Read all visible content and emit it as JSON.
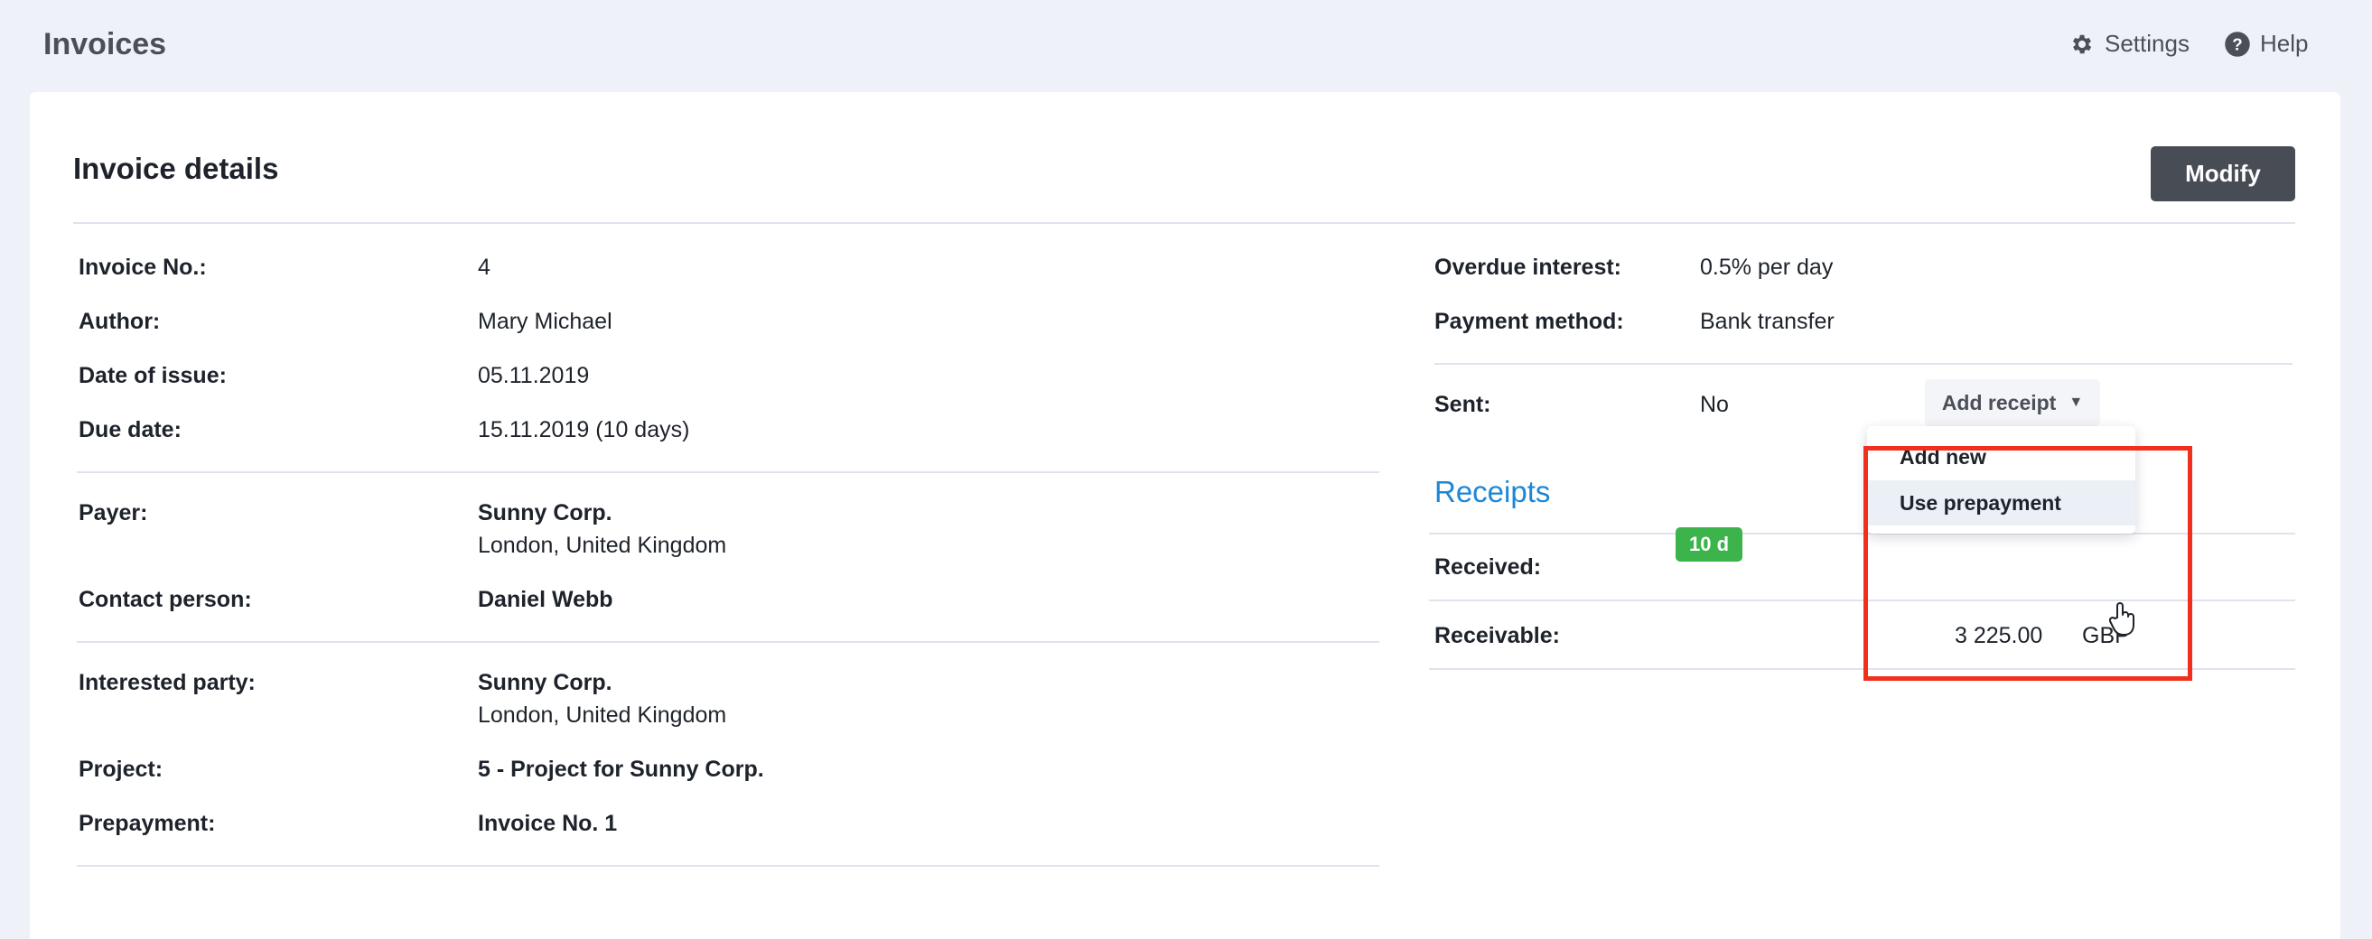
{
  "header": {
    "title": "Invoices",
    "settings_label": "Settings",
    "help_label": "Help",
    "settings_icon": "gear-icon",
    "help_icon": "help-circle-icon"
  },
  "card": {
    "title": "Invoice details",
    "modify_label": "Modify"
  },
  "left": {
    "invoice_no_label": "Invoice No.:",
    "invoice_no_value": "4",
    "author_label": "Author:",
    "author_value": "Mary Michael",
    "issue_label": "Date of issue:",
    "issue_value": "05.11.2019",
    "due_label": "Due date:",
    "due_value": "15.11.2019 (10 days)",
    "payer_label": "Payer:",
    "payer_name": "Sunny Corp.",
    "payer_address": "London, United Kingdom",
    "contact_label": "Contact person:",
    "contact_value": "Daniel Webb",
    "interested_label": "Interested party:",
    "interested_name": "Sunny Corp.",
    "interested_address": "London, United Kingdom",
    "project_label": "Project:",
    "project_value": "5 - Project for Sunny Corp.",
    "prepayment_label": "Prepayment:",
    "prepayment_value": "Invoice No. 1"
  },
  "right": {
    "interest_label": "Overdue interest:",
    "interest_value": "0.5% per day",
    "method_label": "Payment method:",
    "method_value": "Bank transfer",
    "sent_label": "Sent:",
    "sent_value": "No"
  },
  "receipts": {
    "title": "Receipts",
    "add_receipt_label": "Add receipt",
    "received_label": "Received:",
    "receivable_label": "Receivable:",
    "badge": "10 d",
    "amount": "3 225.00",
    "currency": "GBP",
    "menu": {
      "add_new": "Add new",
      "use_prepayment": "Use prepayment"
    }
  },
  "colors": {
    "accent_blue": "#1d87d6",
    "badge_green": "#3cb44b",
    "highlight_red": "#f0301c",
    "modify_button": "#484c55"
  }
}
